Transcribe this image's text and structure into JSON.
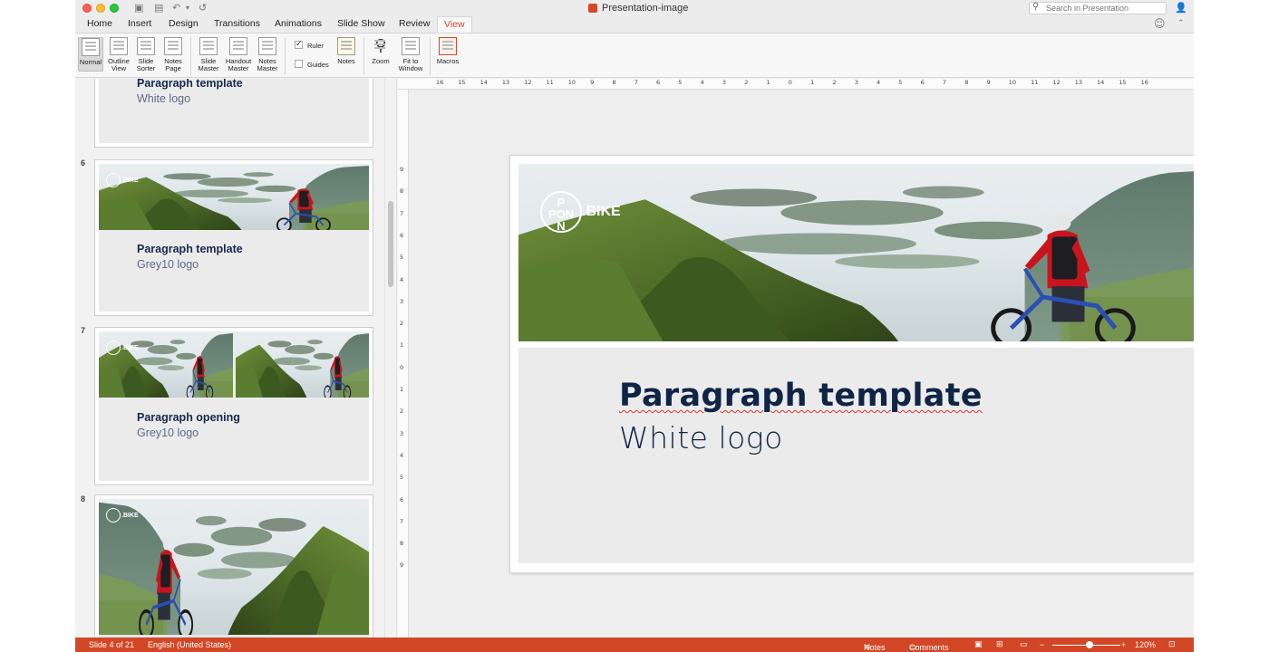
{
  "window": {
    "title": "Presentation-image"
  },
  "search": {
    "placeholder": "Search in Presentation"
  },
  "tabs": [
    {
      "label": "Home"
    },
    {
      "label": "Insert"
    },
    {
      "label": "Design"
    },
    {
      "label": "Transitions"
    },
    {
      "label": "Animations"
    },
    {
      "label": "Slide Show"
    },
    {
      "label": "Review"
    },
    {
      "label": "View",
      "active": true
    }
  ],
  "ribbon": {
    "normal": "Normal",
    "outline_1": "Outline",
    "outline_2": "View",
    "sorter_1": "Slide",
    "sorter_2": "Sorter",
    "notespage_1": "Notes",
    "notespage_2": "Page",
    "slidemaster_1": "Slide",
    "slidemaster_2": "Master",
    "handout_1": "Handout",
    "handout_2": "Master",
    "notesmaster_1": "Notes",
    "notesmaster_2": "Master",
    "ruler": "Ruler",
    "ruler_checked": true,
    "guides": "Guides",
    "guides_checked": false,
    "notes": "Notes",
    "zoom": "Zoom",
    "fit_1": "Fit to",
    "fit_2": "Window",
    "macros": "Macros"
  },
  "thumbnails": [
    {
      "number": "",
      "title": "Paragraph template",
      "subtitle": "White logo"
    },
    {
      "number": "6",
      "title": "Paragraph template",
      "subtitle": "Grey10 logo",
      "logo": ".BIKE"
    },
    {
      "number": "7",
      "title": "Paragraph opening",
      "subtitle": "Grey10 logo",
      "logo": ".BIKE"
    },
    {
      "number": "8",
      "logo": ".BIKE"
    }
  ],
  "ruler": {
    "h_labels": [
      "16",
      "15",
      "14",
      "13",
      "12",
      "11",
      "10",
      "9",
      "8",
      "7",
      "6",
      "5",
      "4",
      "3",
      "2",
      "1",
      "0",
      "1",
      "2",
      "3",
      "4",
      "5",
      "6",
      "7",
      "8",
      "9",
      "10",
      "11",
      "12",
      "13",
      "14",
      "15",
      "16"
    ],
    "v_labels": [
      "9",
      "8",
      "7",
      "6",
      "5",
      "4",
      "3",
      "2",
      "1",
      "0",
      "1",
      "2",
      "3",
      "4",
      "5",
      "6",
      "7",
      "8",
      "9"
    ]
  },
  "slide": {
    "title": "Paragraph template",
    "subtitle": "White logo",
    "logo_letters_top": "P",
    "logo_text": "PON",
    "logo_suffix": ".BIKE",
    "logo_letters_bottom": "N"
  },
  "status": {
    "slide_info": "Slide 4 of 21",
    "language": "English (United States)",
    "notes": "Notes",
    "comments": "Comments",
    "zoom": "120%",
    "zoom_fraction": 0.55
  },
  "colors": {
    "accent": "#d24726",
    "title_text": "#0f2547",
    "thumb_title": "#16294b"
  },
  "icons": [
    "close-icon",
    "minimize-icon",
    "maximize-icon",
    "sidebar-icon",
    "save-icon",
    "undo-icon",
    "redo-icon",
    "search-icon",
    "share-icon",
    "smiley-icon",
    "collapse-icon",
    "normal-view-icon",
    "outline-view-icon",
    "slide-sorter-icon",
    "notes-page-icon",
    "slide-master-icon",
    "handout-master-icon",
    "notes-master-icon",
    "notes-icon",
    "zoom-icon",
    "fit-window-icon",
    "macros-icon",
    "comments-icon",
    "slideshow-icon",
    "fit-slide-icon"
  ]
}
